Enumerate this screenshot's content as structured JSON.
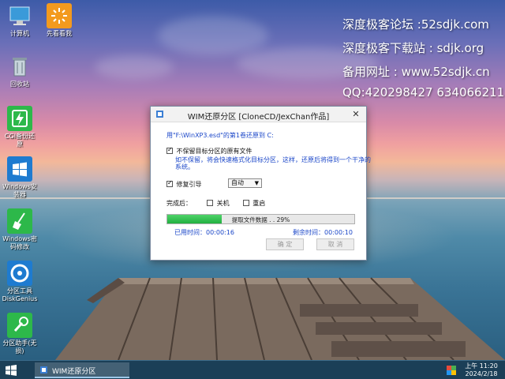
{
  "desktop": {
    "icons": [
      {
        "label": "计算机"
      },
      {
        "label": "先看看我"
      },
      {
        "label": "回收站"
      },
      {
        "label": "CGI备份还原"
      },
      {
        "label": "Windows安装器"
      },
      {
        "label": "Windows密码修改"
      },
      {
        "label": "分区工具DiskGenius"
      },
      {
        "label": "分区助手(无损)"
      }
    ],
    "watermark": [
      "深度极客论坛 :52sdjk.com",
      "深度极客下载站 : sdjk.org",
      "备用网址 : www.52sdjk.cn",
      "QQ:420298427  634066211"
    ]
  },
  "dialog": {
    "title": "WIM还原分区  [CloneCD/JexChan作品]",
    "source_line": "用\"F:\\WinXP3.esd\"的第1卷还原到 C:",
    "keep_files_label": "不保留目标分区的原有文件",
    "keep_files_checked": true,
    "keep_files_note_1": "如不保留，将会快速格式化目标分区，这样，还原后将得到一个干净的",
    "keep_files_note_2": "系统。",
    "repair_boot_label": "修复引导",
    "repair_boot_checked": true,
    "repair_boot_select": "自动",
    "after_label": "完成后：",
    "shutdown_label": "关机",
    "restart_label": "重启",
    "progress_text": "提取文件数据 . . 29%",
    "progress_value": 0.29,
    "elapsed": "已用时间：00:00:16",
    "remaining": "剩余时间：00:00:10",
    "ok_label": "确 定",
    "cancel_label": "取 消"
  },
  "taskbar": {
    "task_label": "WIM还原分区",
    "time": "上午 11:20",
    "date": "2024/2/18"
  }
}
